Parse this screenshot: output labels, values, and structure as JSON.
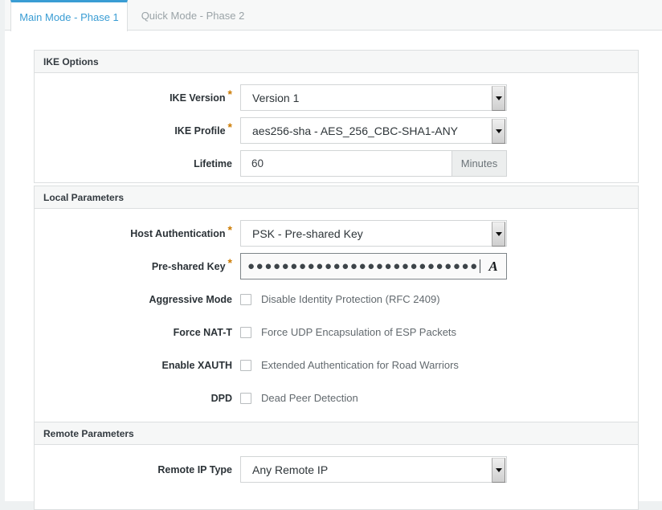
{
  "tabs": [
    {
      "label": "Main Mode - Phase 1",
      "active": true
    },
    {
      "label": "Quick Mode - Phase 2",
      "active": false
    }
  ],
  "accent_color": "#3a9dd4",
  "required_marker": "*",
  "panels": {
    "ike_options": {
      "title": "IKE Options",
      "fields": {
        "ike_version": {
          "label": "IKE Version",
          "value": "Version 1",
          "required": true,
          "type": "select"
        },
        "ike_profile": {
          "label": "IKE Profile",
          "value": "aes256-sha - AES_256_CBC-SHA1-ANY",
          "required": true,
          "type": "select"
        },
        "lifetime": {
          "label": "Lifetime",
          "value": "60",
          "unit": "Minutes",
          "required": false,
          "type": "text"
        }
      }
    },
    "local_parameters": {
      "title": "Local Parameters",
      "fields": {
        "host_authentication": {
          "label": "Host Authentication",
          "value": "PSK - Pre-shared Key",
          "required": true,
          "type": "select"
        },
        "pre_shared_key": {
          "label": "Pre-shared Key",
          "value": "●●●●●●●●●●●●●●●●●●●●●●●●●●●",
          "required": true,
          "type": "password",
          "reveal_icon": "italic-a-icon"
        },
        "aggressive_mode": {
          "label": "Aggressive Mode",
          "checkbox_label": "Disable Identity Protection (RFC 2409)",
          "checked": false,
          "type": "checkbox"
        },
        "force_nat_t": {
          "label": "Force NAT-T",
          "checkbox_label": "Force UDP Encapsulation of ESP Packets",
          "checked": false,
          "type": "checkbox"
        },
        "enable_xauth": {
          "label": "Enable XAUTH",
          "checkbox_label": "Extended Authentication for Road Warriors",
          "checked": false,
          "type": "checkbox"
        },
        "dpd": {
          "label": "DPD",
          "checkbox_label": "Dead Peer Detection",
          "checked": false,
          "type": "checkbox"
        }
      }
    },
    "remote_parameters": {
      "title": "Remote Parameters",
      "fields": {
        "remote_ip_type": {
          "label": "Remote IP Type",
          "value": "Any Remote IP",
          "required": false,
          "type": "select"
        }
      }
    }
  }
}
